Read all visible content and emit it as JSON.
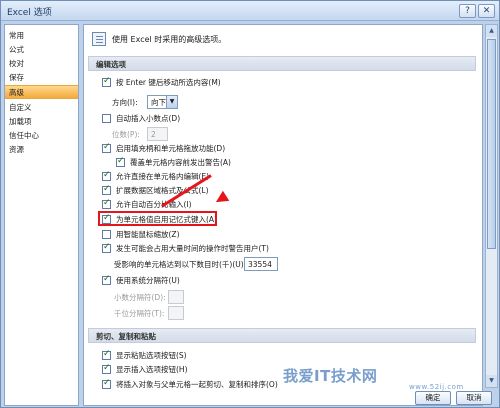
{
  "window": {
    "title": "Excel 选项",
    "help_glyph": "?",
    "close_glyph": "✕"
  },
  "sidebar": {
    "items": [
      {
        "label": "常用"
      },
      {
        "label": "公式"
      },
      {
        "label": "校对"
      },
      {
        "label": "保存"
      },
      {
        "label": "高级",
        "selected": true
      },
      {
        "label": "自定义"
      },
      {
        "label": "加载项"
      },
      {
        "label": "信任中心"
      },
      {
        "label": "资源"
      }
    ]
  },
  "main": {
    "header": "使用 Excel 时采用的高级选项。",
    "sections": {
      "editing": "编辑选项",
      "cut_copy_paste": "剪切、复制和粘贴"
    },
    "options": {
      "enter_move": {
        "label": "按 Enter 键后移动所选内容(M)",
        "checked": true
      },
      "direction_label": "方向(I):",
      "direction_value": "向下",
      "auto_decimal": {
        "label": "自动插入小数点(D)",
        "checked": false
      },
      "places_label": "位数(P):",
      "places_value": "2",
      "fill_handle": {
        "label": "启用填充柄和单元格拖放功能(D)",
        "checked": true
      },
      "overwrite_alert": {
        "label": "覆盖单元格内容前发出警告(A)",
        "checked": true
      },
      "edit_in_cell": {
        "label": "允许直接在单元格内编辑(E)",
        "checked": true
      },
      "extend_formats": {
        "label": "扩展数据区域格式及公式(L)",
        "checked": true
      },
      "auto_percent": {
        "label": "允许自动百分比输入(I)",
        "checked": true
      },
      "autocomplete": {
        "label": "为单元格值启用记忆式键入(A)",
        "checked": true
      },
      "intellimouse": {
        "label": "用智能鼠标缩放(Z)",
        "checked": false
      },
      "alert_slow": {
        "label": "发生可能会占用大量时间的操作时警告用户(T)",
        "checked": true
      },
      "cells_affected_label": "受影响的单元格达到以下数目时(千)(U):",
      "cells_affected_value": "33554",
      "system_separators": {
        "label": "使用系统分隔符(U)",
        "checked": true
      },
      "decimal_sep_label": "小数分隔符(D):",
      "thousands_sep_label": "千位分隔符(T):",
      "paste_options": {
        "label": "显示粘贴选项按钮(S)",
        "checked": true
      },
      "insert_options": {
        "label": "显示插入选项按钮(H)",
        "checked": true
      },
      "cut_copy_sort": {
        "label": "将插入对象与父单元格一起剪切、复制和排序(O)",
        "checked": true
      }
    }
  },
  "footer": {
    "ok": "确定",
    "cancel": "取消"
  },
  "watermark": {
    "text": "我爱IT技术网",
    "site": "www.52ij.com"
  },
  "colors": {
    "selected_nav": "#f4a93e",
    "highlight": "#e5161b",
    "frame": "#bdd1ea"
  }
}
